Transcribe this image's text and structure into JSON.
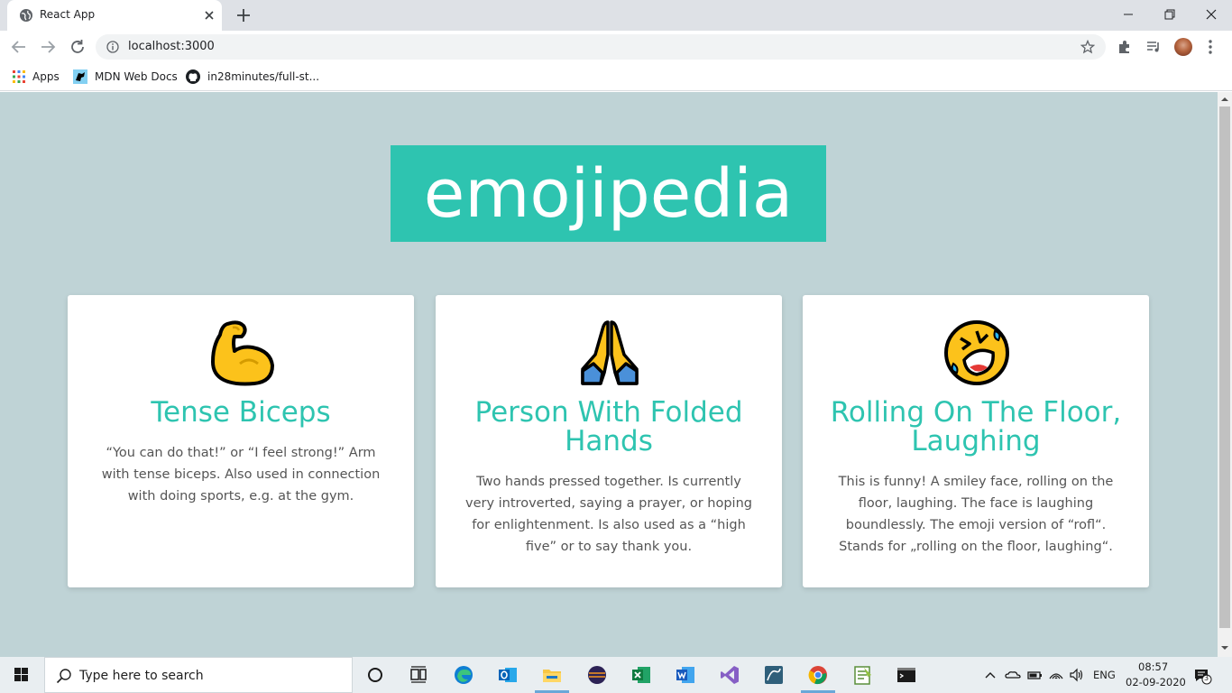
{
  "browser": {
    "tab_title": "React App",
    "url": "localhost:3000",
    "bookmarks": [
      "Apps",
      "MDN Web Docs",
      "in28minutes/full-st..."
    ]
  },
  "page": {
    "heading": "emojipedia",
    "cards": [
      {
        "emoji": "tense-biceps-emoji",
        "title": "Tense Biceps",
        "description": "“You can do that!” or “I feel strong!” Arm with tense biceps. Also used in connection with doing sports, e.g. at the gym."
      },
      {
        "emoji": "folded-hands-emoji",
        "title": "Person With Folded Hands",
        "description": "Two hands pressed together. Is currently very introverted, saying a prayer, or hoping for enlightenment. Is also used as a “high five” or to say thank you."
      },
      {
        "emoji": "rofl-emoji",
        "title": "Rolling On The Floor, Laughing",
        "description": "This is funny! A smiley face, rolling on the floor, laughing. The face is laughing boundlessly. The emoji version of “rofl“. Stands for „rolling on the floor, laughing“."
      }
    ]
  },
  "taskbar": {
    "search_placeholder": "Type here to search",
    "language": "ENG",
    "time": "08:57",
    "date": "02-09-2020",
    "notification_count": "3"
  },
  "colors": {
    "accent": "#2ec4b0",
    "background": "#bfd3d6"
  }
}
